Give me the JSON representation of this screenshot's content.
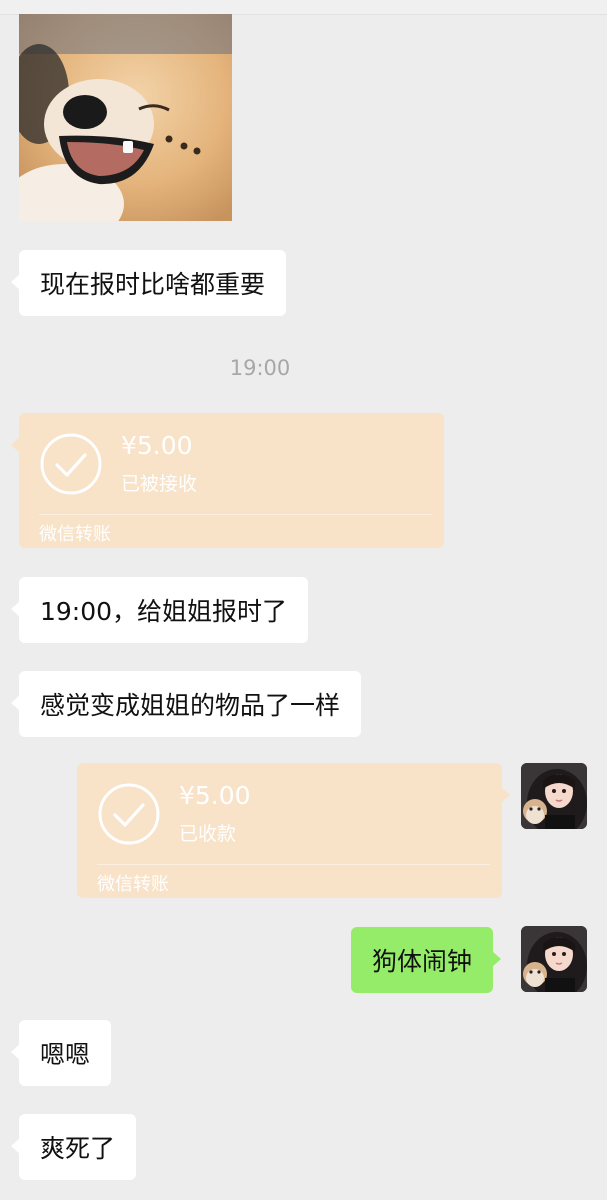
{
  "messages": {
    "msg_report_important": "现在报时比啥都重要",
    "time_divider": "19:00",
    "transfer_received": {
      "amount": "¥5.00",
      "status": "已被接收",
      "footer": "微信转账"
    },
    "msg_report_time": "19:00，给姐姐报时了",
    "msg_feel_like_item": "感觉变成姐姐的物品了一样",
    "transfer_collected": {
      "amount": "¥5.00",
      "status": "已收款",
      "footer": "微信转账"
    },
    "msg_dog_alarm": "狗体闹钟",
    "msg_enen": "嗯嗯",
    "msg_shuang": "爽死了"
  },
  "colors": {
    "background": "#ededed",
    "left_bubble": "#ffffff",
    "right_bubble": "#95ec69",
    "transfer_card": "#f8e2c8"
  },
  "icons": {
    "transfer_check": "check-circle-icon"
  }
}
